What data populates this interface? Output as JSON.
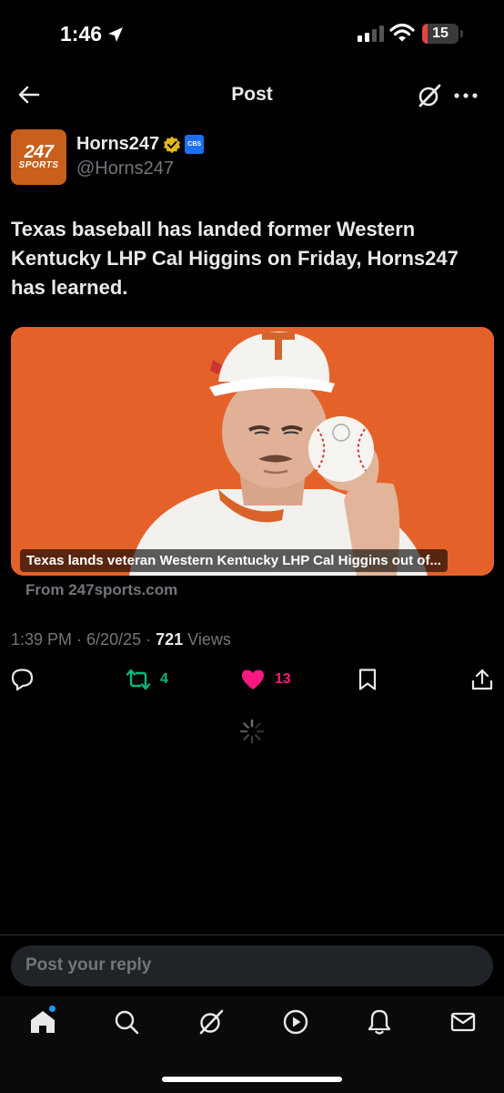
{
  "status_bar": {
    "time": "1:46",
    "battery": "15",
    "battery_level": 0.15
  },
  "header": {
    "title": "Post"
  },
  "author": {
    "avatar_top": "247",
    "avatar_bottom": "SPORTS",
    "name": "Horns247",
    "affiliate_badge": "CBS",
    "handle": "@Horns247"
  },
  "tweet": {
    "text": "Texas baseball has landed former Western Kentucky LHP Cal Higgins on Friday, Horns247 has learned."
  },
  "card": {
    "caption": "Texas lands veteran Western Kentucky LHP Cal Higgins out of...",
    "source": "From 247sports.com"
  },
  "meta": {
    "time": "1:39 PM",
    "date": "6/20/25",
    "views": "721",
    "views_label": "Views"
  },
  "actions": {
    "retweets": "4",
    "likes": "13"
  },
  "reply_box": {
    "placeholder": "Post your reply"
  },
  "colors": {
    "retweet": "#00ba7c",
    "like": "#f91880",
    "accent": "#1d9bf0",
    "card_bg": "#e4622a"
  },
  "icons": [
    "back-arrow-icon",
    "grok-icon",
    "more-icon",
    "verified-icon",
    "reply-icon",
    "retweet-icon",
    "heart-icon",
    "bookmark-icon",
    "share-icon",
    "loading-spinner-icon",
    "home-icon",
    "search-icon",
    "play-icon",
    "bell-icon",
    "mail-icon"
  ]
}
